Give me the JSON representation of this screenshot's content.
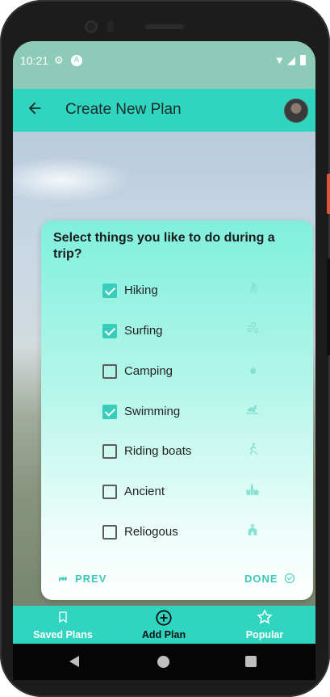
{
  "status_bar": {
    "time": "10:21",
    "left_icons": [
      "gear-icon",
      "app-notification-icon"
    ],
    "right_icons": [
      "wifi-icon",
      "signal-icon",
      "battery-icon"
    ]
  },
  "app_bar": {
    "title": "Create New Plan",
    "back_icon": "arrow-left-icon",
    "avatar": "user-avatar"
  },
  "card": {
    "question": "Select things you like to do during a trip?",
    "options": [
      {
        "label": "Hiking",
        "checked": true,
        "icon": "hiking-icon"
      },
      {
        "label": "Surfing",
        "checked": true,
        "icon": "wind-icon"
      },
      {
        "label": "Camping",
        "checked": false,
        "icon": "fire-icon"
      },
      {
        "label": "Swimming",
        "checked": true,
        "icon": "swimming-icon"
      },
      {
        "label": "Riding boats",
        "checked": false,
        "icon": "rowing-icon"
      },
      {
        "label": "Ancient",
        "checked": false,
        "icon": "castle-icon"
      },
      {
        "label": "Reliogous",
        "checked": false,
        "icon": "church-icon"
      }
    ],
    "prev_label": "PREV",
    "done_label": "DONE"
  },
  "bottom_nav": {
    "items": [
      {
        "label": "Saved Plans",
        "icon": "bookmark-icon",
        "active": false
      },
      {
        "label": "Add Plan",
        "icon": "add-circle-icon",
        "active": true
      },
      {
        "label": "Popular",
        "icon": "star-icon",
        "active": false
      }
    ]
  },
  "colors": {
    "accent": "#30d5c0",
    "checkbox_checked": "#38cdbb",
    "action_text": "#3bc9b5"
  }
}
